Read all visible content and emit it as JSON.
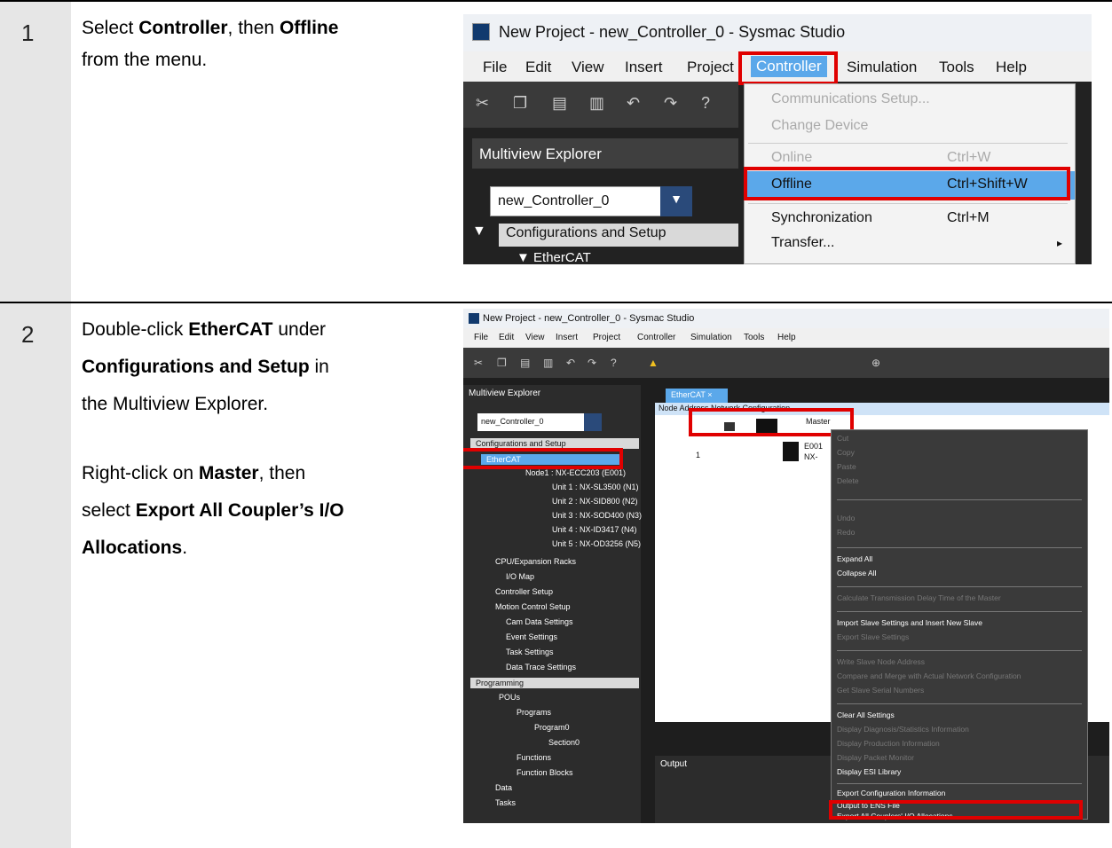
{
  "step1": {
    "number": "1",
    "line1_pre": "Select ",
    "line1_b1": "Controller",
    "line1_mid": ", then ",
    "line1_b2": "Offline",
    "line2": "from the menu."
  },
  "step2": {
    "number": "2",
    "l1_pre": "Double-click ",
    "l1_b": "EtherCAT",
    "l1_post": " under",
    "l2_b": "Configurations and Setup",
    "l2_post": " in",
    "l3": "the Multiview Explorer.",
    "l4_pre": "Right-click on ",
    "l4_b": "Master",
    "l4_post": ", then",
    "l5_pre": "select ",
    "l5_b": "Export All Coupler’s I/O",
    "l6_b": "Allocations",
    "l6_post": "."
  },
  "shot1": {
    "title": "New Project - new_Controller_0 - Sysmac Studio",
    "menu": [
      "File",
      "Edit",
      "View",
      "Insert",
      "Project",
      "Controller",
      "Simulation",
      "Tools",
      "Help"
    ],
    "explorer": "Multiview Explorer",
    "controller_select": "new_Controller_0",
    "tree_config": "Configurations and Setup",
    "tree_ethercat": "EtherCAT",
    "dropdown": {
      "comm": "Communications Setup...",
      "change": "Change Device",
      "online": "Online",
      "online_sc": "Ctrl+W",
      "offline": "Offline",
      "offline_sc": "Ctrl+Shift+W",
      "sync": "Synchronization",
      "sync_sc": "Ctrl+M",
      "transfer": "Transfer..."
    }
  },
  "shot2": {
    "title": "New Project - new_Controller_0 - Sysmac Studio",
    "menu": [
      "File",
      "Edit",
      "View",
      "Insert",
      "Project",
      "Controller",
      "Simulation",
      "Tools",
      "Help"
    ],
    "explorer": "Multiview Explorer",
    "controller_select": "new_Controller_0",
    "tab": "EtherCAT",
    "node_header": "Node Address Network Configuration",
    "master": "Master",
    "row_num": "1",
    "node_id": "E001",
    "node_type": "NX-",
    "output": "Output",
    "tree": [
      "Configurations and Setup",
      "EtherCAT",
      "Node1 : NX-ECC203 (E001)",
      "Unit 1 : NX-SL3500 (N1)",
      "Unit 2 : NX-SID800 (N2)",
      "Unit 3 : NX-SOD400 (N3)",
      "Unit 4 : NX-ID3417 (N4)",
      "Unit 5 : NX-OD3256 (N5)",
      "CPU/Expansion Racks",
      "I/O Map",
      "Controller Setup",
      "Motion Control Setup",
      "Cam Data Settings",
      "Event Settings",
      "Task Settings",
      "Data Trace Settings",
      "Programming",
      "POUs",
      "Programs",
      "Program0",
      "Section0",
      "Functions",
      "Function Blocks",
      "Data",
      "Tasks"
    ],
    "ctx": {
      "cut": "Cut",
      "copy": "Copy",
      "paste": "Paste",
      "delete": "Delete",
      "undo": "Undo",
      "redo": "Redo",
      "expand": "Expand All",
      "collapse": "Collapse All",
      "calc": "Calculate Transmission Delay Time of the Master",
      "import": "Import Slave Settings and Insert New Slave",
      "export_slave": "Export Slave Settings",
      "write": "Write Slave Node Address",
      "compare": "Compare and Merge with Actual Network Configuration",
      "serial": "Get Slave Serial Numbers",
      "clear": "Clear All Settings",
      "diag": "Display Diagnosis/Statistics Information",
      "prod": "Display Production Information",
      "packet": "Display Packet Monitor",
      "esi": "Display ESI Library",
      "exportcfg": "Export Configuration Information",
      "ens": "Output to ENS File",
      "exportall": "Export All Couplers' I/O Allocations"
    }
  }
}
